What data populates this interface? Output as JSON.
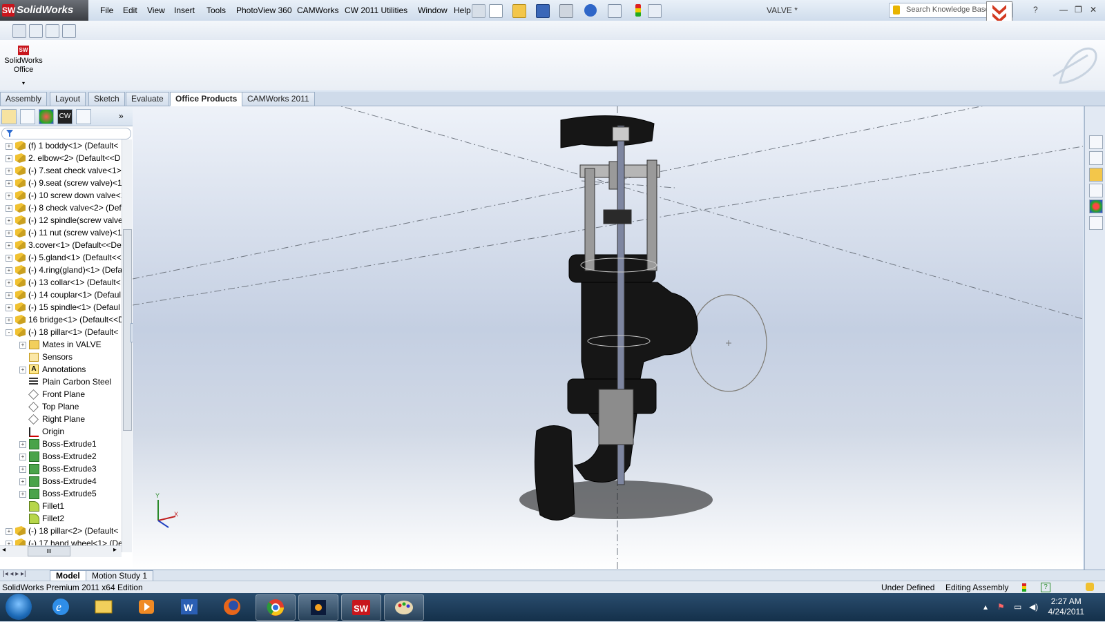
{
  "app": {
    "name": "SolidWorks",
    "document_title": "VALVE *"
  },
  "menu": [
    "File",
    "Edit",
    "View",
    "Insert",
    "Tools",
    "PhotoView 360",
    "CAMWorks",
    "CW 2011 Utilities",
    "Window",
    "Help"
  ],
  "search": {
    "placeholder": "Search Knowledge Base"
  },
  "command_manager": {
    "office_button": "SolidWorks Office"
  },
  "tabs": [
    "Assembly",
    "Layout",
    "Sketch",
    "Evaluate",
    "Office Products",
    "CAMWorks 2011"
  ],
  "active_tab": "Office Products",
  "tree": [
    {
      "label": "(f) 1 boddy<1> (Default<",
      "icon": "assembly-icon",
      "expand": "+",
      "indent": 0
    },
    {
      "label": "2. elbow<2> (Default<<D",
      "icon": "assembly-icon",
      "expand": "+",
      "indent": 0
    },
    {
      "label": "(-) 7.seat check valve<1>",
      "icon": "assembly-icon",
      "expand": "+",
      "indent": 0
    },
    {
      "label": "(-) 9.seat (screw valve)<1>",
      "icon": "assembly-icon",
      "expand": "+",
      "indent": 0
    },
    {
      "label": "(-) 10 screw down valve<1",
      "icon": "assembly-icon",
      "expand": "+",
      "indent": 0
    },
    {
      "label": "(-) 8 check valve<2> (Def",
      "icon": "assembly-icon",
      "expand": "+",
      "indent": 0
    },
    {
      "label": "(-) 12 spindle(screw valve",
      "icon": "assembly-icon",
      "expand": "+",
      "indent": 0
    },
    {
      "label": "(-) 11 nut (screw valve)<1",
      "icon": "assembly-icon",
      "expand": "+",
      "indent": 0
    },
    {
      "label": "3.cover<1> (Default<<De",
      "icon": "assembly-icon",
      "expand": "+",
      "indent": 0
    },
    {
      "label": "(-) 5.gland<1> (Default<<",
      "icon": "assembly-icon",
      "expand": "+",
      "indent": 0
    },
    {
      "label": "(-) 4.ring(gland)<1> (Defa",
      "icon": "assembly-icon",
      "expand": "+",
      "indent": 0
    },
    {
      "label": "(-) 13 collar<1> (Default<",
      "icon": "assembly-icon",
      "expand": "+",
      "indent": 0
    },
    {
      "label": "(-) 14 couplar<1> (Defaul",
      "icon": "assembly-icon",
      "expand": "+",
      "indent": 0
    },
    {
      "label": "(-) 15 spindle<1> (Defaul",
      "icon": "assembly-icon",
      "expand": "+",
      "indent": 0
    },
    {
      "label": "16 bridge<1> (Default<<D",
      "icon": "assembly-icon",
      "expand": "+",
      "indent": 0
    },
    {
      "label": "(-) 18 pillar<1> (Default<",
      "icon": "assembly-icon",
      "expand": "-",
      "indent": 0
    },
    {
      "label": "Mates in VALVE",
      "icon": "mates-folder-icon",
      "expand": "+",
      "indent": 1
    },
    {
      "label": "Sensors",
      "icon": "sensor-icon",
      "expand": "",
      "indent": 1
    },
    {
      "label": "Annotations",
      "icon": "annotation-icon",
      "expand": "+",
      "indent": 1
    },
    {
      "label": "Plain Carbon Steel",
      "icon": "material-icon",
      "expand": "",
      "indent": 1
    },
    {
      "label": "Front Plane",
      "icon": "plane-icon",
      "expand": "",
      "indent": 1
    },
    {
      "label": "Top Plane",
      "icon": "plane-icon",
      "expand": "",
      "indent": 1
    },
    {
      "label": "Right Plane",
      "icon": "plane-icon",
      "expand": "",
      "indent": 1
    },
    {
      "label": "Origin",
      "icon": "origin-icon",
      "expand": "",
      "indent": 1
    },
    {
      "label": "Boss-Extrude1",
      "icon": "feature-icon",
      "expand": "+",
      "indent": 1
    },
    {
      "label": "Boss-Extrude2",
      "icon": "feature-icon",
      "expand": "+",
      "indent": 1
    },
    {
      "label": "Boss-Extrude3",
      "icon": "feature-icon",
      "expand": "+",
      "indent": 1
    },
    {
      "label": "Boss-Extrude4",
      "icon": "feature-icon",
      "expand": "+",
      "indent": 1
    },
    {
      "label": "Boss-Extrude5",
      "icon": "feature-icon",
      "expand": "+",
      "indent": 1
    },
    {
      "label": "Fillet1",
      "icon": "fillet-icon",
      "expand": "",
      "indent": 1
    },
    {
      "label": "Fillet2",
      "icon": "fillet-icon",
      "expand": "",
      "indent": 1
    },
    {
      "label": "(-) 18 pillar<2> (Default<",
      "icon": "assembly-icon",
      "expand": "+",
      "indent": 0
    },
    {
      "label": "(-) 17 hand wheel<1> (De",
      "icon": "assembly-icon",
      "expand": "+",
      "indent": 0
    }
  ],
  "hscroll_label": "III",
  "bottom_tabs": [
    "Model",
    "Motion Study 1"
  ],
  "active_bottom_tab": "Model",
  "status": {
    "edition": "SolidWorks Premium 2011 x64 Edition",
    "state": "Under Defined",
    "mode": "Editing Assembly"
  },
  "clock": {
    "time": "2:27 AM",
    "date": "4/24/2011"
  },
  "triad_labels": {
    "y": "Y",
    "x": "X"
  },
  "colors": {
    "accent": "#c8161d",
    "viewport_top": "#eef2f9",
    "viewport_mid": "#c4cfe2",
    "model_dark": "#161616"
  }
}
